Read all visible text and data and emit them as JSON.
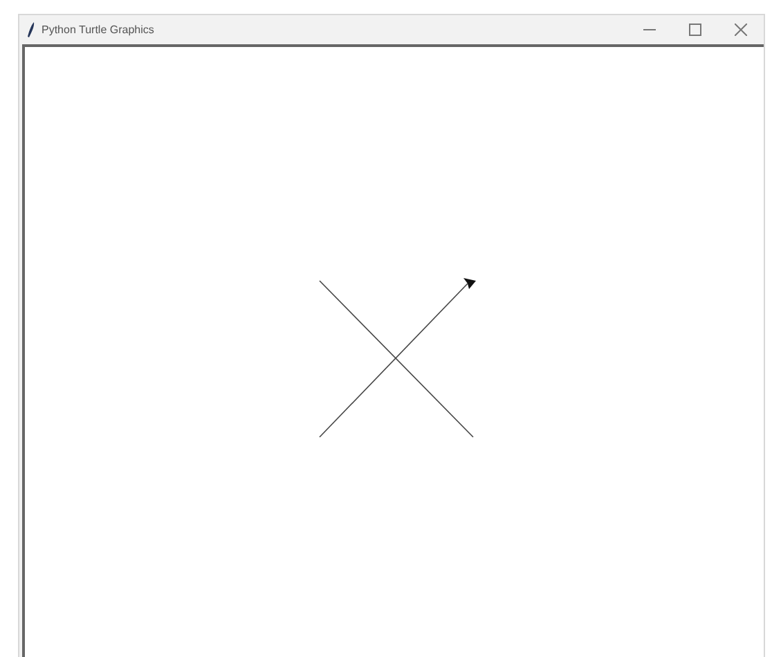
{
  "window": {
    "title": "Python Turtle Graphics"
  }
}
